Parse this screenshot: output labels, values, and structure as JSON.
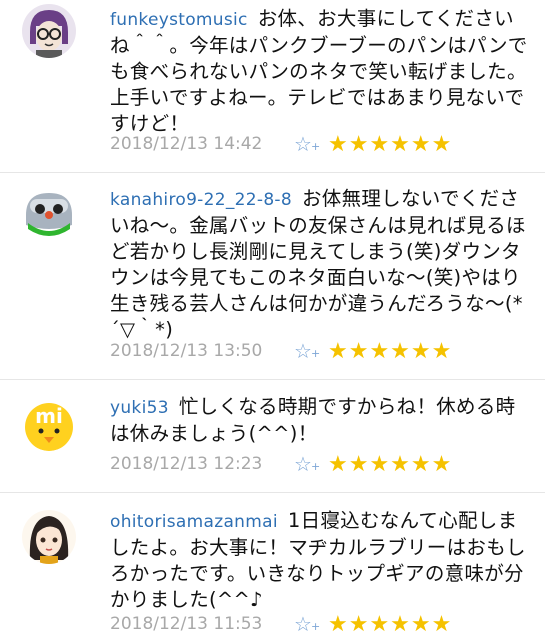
{
  "comments": [
    {
      "username": "funkeystomusic",
      "text": "お体、お大事にしてくださいね＾＾。今年はパンクブーブーのパンはパンでも食べられないパンのネタで笑い転げました。上手いですよねー。テレビではあまり見ないですけど！",
      "timestamp": "2018/12/13 14:42",
      "rating_stars": "★★★★★★",
      "rating_value": 6,
      "avatar_icon": "glasses-face-avatar-icon"
    },
    {
      "username": "kanahiro9-22_22-8-8",
      "text": "お体無理しないでくださいね～。金属バットの友保さんは見れば見るほど若かりし長渕剛に見えてしまう(笑)ダウンタウンは今見てもこのネタ面白いな～(笑)やはり生き残る芸人さんは何かが違うんだろうな～(*´▽｀*)",
      "timestamp": "2018/12/13 13:50",
      "rating_stars": "★★★★★★",
      "rating_value": 6,
      "avatar_icon": "robot-face-avatar-icon"
    },
    {
      "username": "yuki53",
      "text": "忙しくなる時期ですからね！休める時は休みましょう(^^)！",
      "timestamp": "2018/12/13 12:23",
      "rating_stars": "★★★★★★",
      "rating_value": 6,
      "avatar_icon": "yellow-mi-bird-avatar-icon"
    },
    {
      "username": "ohitorisamazanmai",
      "text": "1日寝込むなんて心配しましたよ。お大事に！マヂカルラブリーはおもしろかったです。いきなりトップギアの意味が分かりました(^^♪",
      "timestamp": "2018/12/13 11:53",
      "rating_stars": "★★★★★★",
      "rating_value": 6,
      "avatar_icon": "anime-girl-avatar-icon"
    }
  ],
  "colors": {
    "username": "#2e6fb3",
    "timestamp": "#a8a8a8",
    "star": "#f5c200",
    "fav_icon": "#7da6d6"
  },
  "icons": {
    "favorite": "star-plus-icon",
    "rating": "star-icon"
  }
}
